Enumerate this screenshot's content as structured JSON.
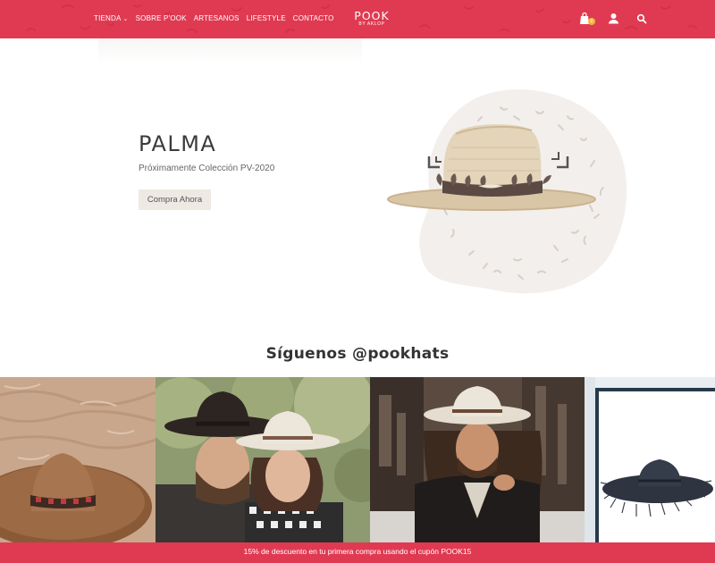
{
  "header": {
    "nav": [
      {
        "label": "TIENDA",
        "has_caret": true
      },
      {
        "label": "SOBRE P'OOK"
      },
      {
        "label": "ARTESANOS"
      },
      {
        "label": "LIFESTYLE"
      },
      {
        "label": "CONTACTO"
      }
    ],
    "logo": {
      "main": "POOK",
      "sub": "BY AKLOP"
    },
    "icons": [
      "shopping-bag-icon",
      "user-icon",
      "search-icon"
    ],
    "cart_count": "0",
    "brand_color": "#e03a52"
  },
  "hero": {
    "title": "PALMA",
    "subtitle": "Próximamente Colección PV-2020",
    "button_label": "Compra Ahora"
  },
  "follow": {
    "title": "Síguenos @pookhats"
  },
  "gallery": {
    "items": [
      "instagram-photo-hat-on-sand",
      "instagram-photo-couple",
      "instagram-photo-man-with-hat",
      "instagram-photo-black-hat"
    ]
  },
  "promo": {
    "text": "15% de descuento en tu primera compra usando el cupón POOK15"
  }
}
